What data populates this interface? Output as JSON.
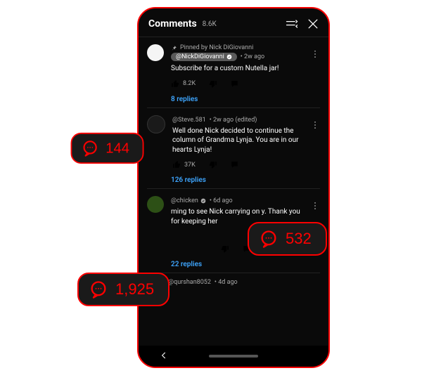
{
  "header": {
    "title": "Comments",
    "count_label": "8.6K"
  },
  "comments": [
    {
      "pinned_by": "Pinned by Nick DiGiovanni",
      "author_chip": "@NickDiGiovanni",
      "verified": true,
      "time": "2w ago",
      "text": "Subscribe for a custom Nutella jar!",
      "likes": "8.2K",
      "replies": "8 replies"
    },
    {
      "author": "@Steve.581",
      "time": "2w ago (edited)",
      "text": "Well done Nick decided to continue the column of Grandma Lynja. You are in our hearts Lynja!",
      "likes": "37K",
      "replies": "126 replies"
    },
    {
      "author": "@chicken",
      "verified": true,
      "time": "6d ago",
      "text": "ming to see Nick carrying on  y. Thank you for keeping her ",
      "replies": "22 replies"
    },
    {
      "author": "@qurshan8052",
      "time": "4d ago"
    }
  ],
  "badges": {
    "b1": "144",
    "b2": "532",
    "b3": "1,925"
  }
}
